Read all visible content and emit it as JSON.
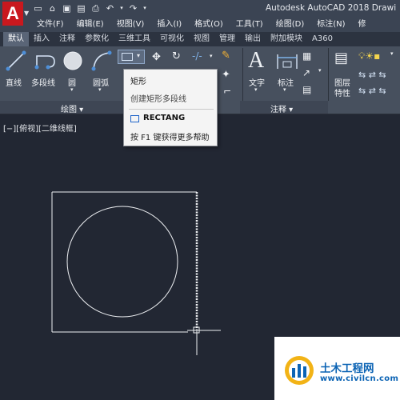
{
  "app": {
    "logo_letter": "A",
    "window_title": "Autodesk AutoCAD 2018   Drawi"
  },
  "quick_access": [
    "new-icon",
    "open-icon",
    "save-icon",
    "save-as-icon",
    "print-icon",
    "undo-icon",
    "redo-icon"
  ],
  "menu": [
    "文件(F)",
    "编辑(E)",
    "视图(V)",
    "插入(I)",
    "格式(O)",
    "工具(T)",
    "绘图(D)",
    "标注(N)",
    "修"
  ],
  "tabs": [
    "默认",
    "插入",
    "注释",
    "参数化",
    "三维工具",
    "可视化",
    "视图",
    "管理",
    "输出",
    "附加模块",
    "A360"
  ],
  "ribbon": {
    "draw": {
      "line": "直线",
      "polyline": "多段线",
      "circle": "圆",
      "arc": "圆弧",
      "panel_title": "绘图 ▾"
    },
    "annotation": {
      "text": "文字",
      "dimension": "标注",
      "panel_title": "注释 ▾"
    },
    "layers": {
      "properties_line1": "图层",
      "properties_line2": "特性"
    }
  },
  "tooltip": {
    "title": "矩形",
    "description": "创建矩形多段线",
    "command": "RECTANG",
    "help": "按 F1 键获得更多帮助"
  },
  "viewport": {
    "label": "[−][俯视][二维线框]"
  },
  "watermark": {
    "text": "土木工程网",
    "url": "www.civilcn.com"
  },
  "colors": {
    "accent_red": "#c9181e",
    "ribbon": "#47505e",
    "canvas": "#222733",
    "watermark_blue": "#0b63b4"
  }
}
